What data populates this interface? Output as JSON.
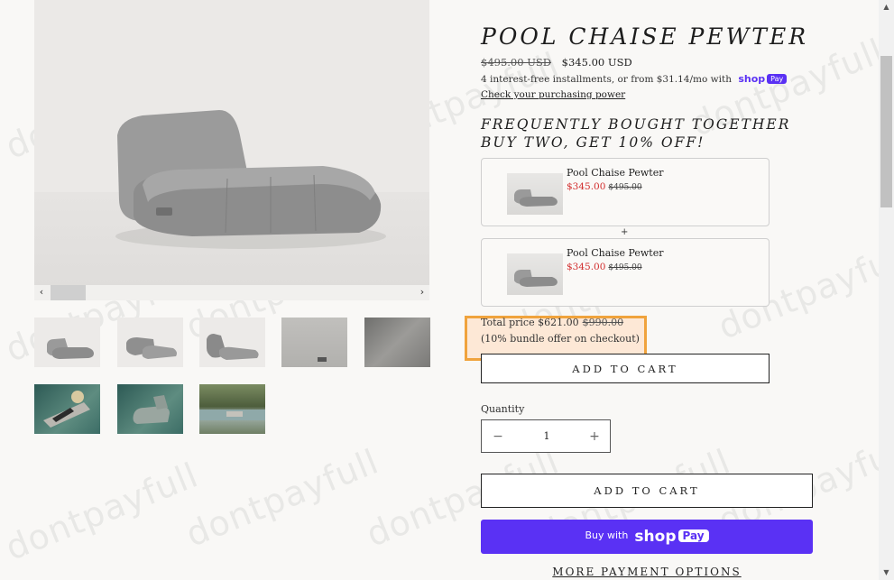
{
  "product": {
    "title": "POOL CHAISE PEWTER",
    "price_old": "$495.00 USD",
    "price_new": "$345.00 USD",
    "installments_text": "4 interest-free installments, or from $31.14/mo with",
    "shop_pay_word": "shop",
    "shop_pay_badge": "Pay",
    "check_link": "Check your purchasing power"
  },
  "gallery": {
    "prev_label": "‹",
    "next_label": "›",
    "thumbnails": [
      "chaise-side",
      "chaise-angle",
      "chaise-back",
      "chaise-closeup",
      "fabric-detail",
      "pool-lounging",
      "pool-floating",
      "garden-pool"
    ]
  },
  "bundle": {
    "heading_line1": "FREQUENTLY BOUGHT TOGETHER",
    "heading_line2": "BUY TWO, GET 10% OFF!",
    "items": [
      {
        "name": "Pool Chaise Pewter",
        "price": "$345.00",
        "old_price": "$495.00"
      },
      {
        "name": "Pool Chaise Pewter",
        "price": "$345.00",
        "old_price": "$495.00"
      }
    ],
    "plus": "+",
    "total_label": "Total price",
    "total_price": "$621.00",
    "total_old": "$990.00",
    "note": "(10% bundle offer on checkout)",
    "add_to_cart": "ADD TO CART"
  },
  "quantity": {
    "label": "Quantity",
    "minus": "−",
    "value": "1",
    "plus": "+"
  },
  "actions": {
    "add_to_cart": "ADD TO CART",
    "buy_with": "Buy with",
    "shop": "shop",
    "pay": "Pay",
    "more_options": "MORE PAYMENT OPTIONS"
  },
  "watermark": "dontpayfull",
  "colors": {
    "shop_pay": "#5a31f4",
    "sale_red": "#d12c2c",
    "highlight_border": "#f0a33d",
    "highlight_fill": "#fde8d6"
  }
}
